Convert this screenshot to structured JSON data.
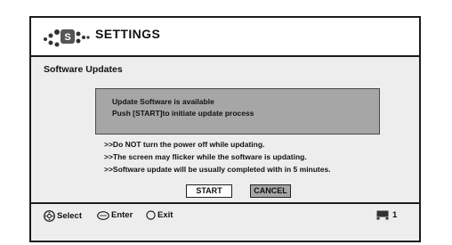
{
  "header": {
    "title": "SETTINGS",
    "icon": "settings-dots-icon"
  },
  "section": {
    "title": "Software Updates"
  },
  "message": {
    "line1": "Update Software is available",
    "line2": "Push [START]to initiate update process"
  },
  "notes": [
    ">>Do NOT turn the power off while updating.",
    ">>The screen may flicker while the software is updating.",
    ">>Software update will be usually completed with in 5 minutes."
  ],
  "buttons": {
    "start": "START",
    "cancel": "CANCEL"
  },
  "footer": {
    "select": "Select",
    "enter": "Enter",
    "exit": "Exit",
    "page": "1"
  },
  "colors": {
    "box_gray": "#a6a6a6",
    "screen_bg": "#ededed",
    "border": "#1c1c1c"
  }
}
